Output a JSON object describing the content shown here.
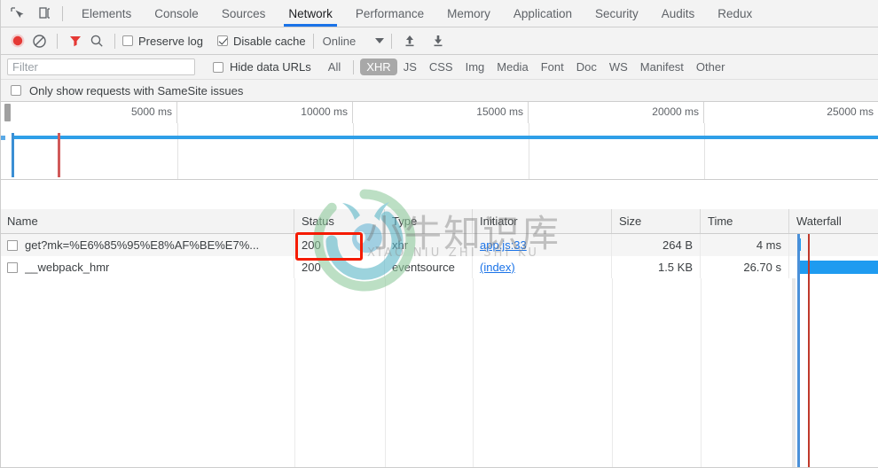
{
  "tabbar": {
    "icons": [
      {
        "name": "inspect-element-icon",
        "glyph": "inspect"
      },
      {
        "name": "device-toolbar-icon",
        "glyph": "device"
      }
    ],
    "tabs": [
      {
        "label": "Elements",
        "active": false
      },
      {
        "label": "Console",
        "active": false
      },
      {
        "label": "Sources",
        "active": false
      },
      {
        "label": "Network",
        "active": true
      },
      {
        "label": "Performance",
        "active": false
      },
      {
        "label": "Memory",
        "active": false
      },
      {
        "label": "Application",
        "active": false
      },
      {
        "label": "Security",
        "active": false
      },
      {
        "label": "Audits",
        "active": false
      },
      {
        "label": "Redux",
        "active": false
      }
    ],
    "active_tab_underline_color": "#1a73e8"
  },
  "controls": {
    "record_button": {
      "name": "record-button",
      "state": "recording",
      "color": "#e53935"
    },
    "clear_button": {
      "name": "clear-button"
    },
    "filter_button": {
      "name": "filter-funnel-icon",
      "state": "active",
      "color": "#e53935"
    },
    "search_button": {
      "name": "search-icon"
    },
    "preserve_log": {
      "label": "Preserve log",
      "checked": false
    },
    "disable_cache": {
      "label": "Disable cache",
      "checked": true
    },
    "throttling": {
      "value": "Online"
    },
    "import_button": {
      "name": "import-har-icon"
    },
    "export_button": {
      "name": "export-har-icon"
    }
  },
  "filterbar": {
    "filter_placeholder": "Filter",
    "filter_value": "",
    "hide_data_urls": {
      "label": "Hide data URLs",
      "checked": false
    },
    "types": [
      {
        "label": "All",
        "active": false
      },
      {
        "label": "XHR",
        "active": true
      },
      {
        "label": "JS",
        "active": false
      },
      {
        "label": "CSS",
        "active": false
      },
      {
        "label": "Img",
        "active": false
      },
      {
        "label": "Media",
        "active": false
      },
      {
        "label": "Font",
        "active": false
      },
      {
        "label": "Doc",
        "active": false
      },
      {
        "label": "WS",
        "active": false
      },
      {
        "label": "Manifest",
        "active": false
      },
      {
        "label": "Other",
        "active": false
      }
    ],
    "samesite": {
      "label": "Only show requests with SameSite issues",
      "checked": false
    }
  },
  "overview": {
    "ticks": [
      "5000 ms",
      "10000 ms",
      "15000 ms",
      "20000 ms",
      "25000 ms"
    ],
    "marker_dom_content_loaded_color": "#3b8fd4",
    "marker_load_color": "#d05a5a"
  },
  "table": {
    "columns": [
      {
        "label": "Name",
        "align": "left"
      },
      {
        "label": "Status",
        "align": "left"
      },
      {
        "label": "Type",
        "align": "left"
      },
      {
        "label": "Initiator",
        "align": "left"
      },
      {
        "label": "Size",
        "align": "right"
      },
      {
        "label": "Time",
        "align": "right"
      },
      {
        "label": "Waterfall",
        "align": "left"
      }
    ],
    "rows": [
      {
        "name": "get?mk=%E6%85%95%E8%AF%BE%E7%...",
        "status": "200",
        "type": "xhr",
        "initiator": "app.js:33",
        "size": "264 B",
        "time": "4 ms"
      },
      {
        "name": "__webpack_hmr",
        "status": "200",
        "type": "eventsource",
        "initiator": "(index)",
        "size": "1.5 KB",
        "time": "26.70 s"
      }
    ]
  },
  "annotation": {
    "name": "status-highlight-box",
    "color": "#f51b00"
  },
  "watermark": {
    "chinese": "小牛知识库",
    "pinyin": "XIAO NIU ZHI SHI KU",
    "logo_colors": [
      "#8cc99a",
      "#5bb7c4",
      "#4aa8cf"
    ]
  }
}
